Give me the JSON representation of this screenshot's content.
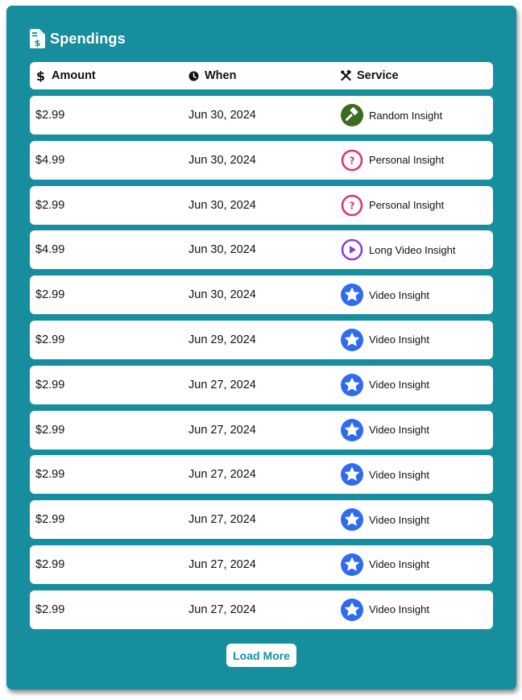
{
  "panel": {
    "title": "Spendings",
    "title_icon": "dollar-document-icon",
    "accent_color": "#178e9e"
  },
  "table": {
    "columns": [
      {
        "label": "Amount",
        "icon": "dollar-icon"
      },
      {
        "label": "When",
        "icon": "clock-icon"
      },
      {
        "label": "Service",
        "icon": "tools-icon"
      }
    ],
    "rows": [
      {
        "amount": "$2.99",
        "when": "Jun 30, 2024",
        "service": "Random Insight",
        "icon": "random-insight-icon"
      },
      {
        "amount": "$4.99",
        "when": "Jun 30, 2024",
        "service": "Personal Insight",
        "icon": "question-icon"
      },
      {
        "amount": "$2.99",
        "when": "Jun 30, 2024",
        "service": "Personal Insight",
        "icon": "question-icon"
      },
      {
        "amount": "$4.99",
        "when": "Jun 30, 2024",
        "service": "Long Video Insight",
        "icon": "play-icon"
      },
      {
        "amount": "$2.99",
        "when": "Jun 30, 2024",
        "service": "Video Insight",
        "icon": "star-icon"
      },
      {
        "amount": "$2.99",
        "when": "Jun 29, 2024",
        "service": "Video Insight",
        "icon": "star-icon"
      },
      {
        "amount": "$2.99",
        "when": "Jun 27, 2024",
        "service": "Video Insight",
        "icon": "star-icon"
      },
      {
        "amount": "$2.99",
        "when": "Jun 27, 2024",
        "service": "Video Insight",
        "icon": "star-icon"
      },
      {
        "amount": "$2.99",
        "when": "Jun 27, 2024",
        "service": "Video Insight",
        "icon": "star-icon"
      },
      {
        "amount": "$2.99",
        "when": "Jun 27, 2024",
        "service": "Video Insight",
        "icon": "star-icon"
      },
      {
        "amount": "$2.99",
        "when": "Jun 27, 2024",
        "service": "Video Insight",
        "icon": "star-icon"
      },
      {
        "amount": "$2.99",
        "when": "Jun 27, 2024",
        "service": "Video Insight",
        "icon": "star-icon"
      }
    ]
  },
  "icon_colors": {
    "random-insight-icon": "#3d6b1c",
    "question-icon": "#d63384",
    "play-icon": "#8a3ee0",
    "star-icon": "#2f6bed"
  },
  "load_more_label": "Load More"
}
